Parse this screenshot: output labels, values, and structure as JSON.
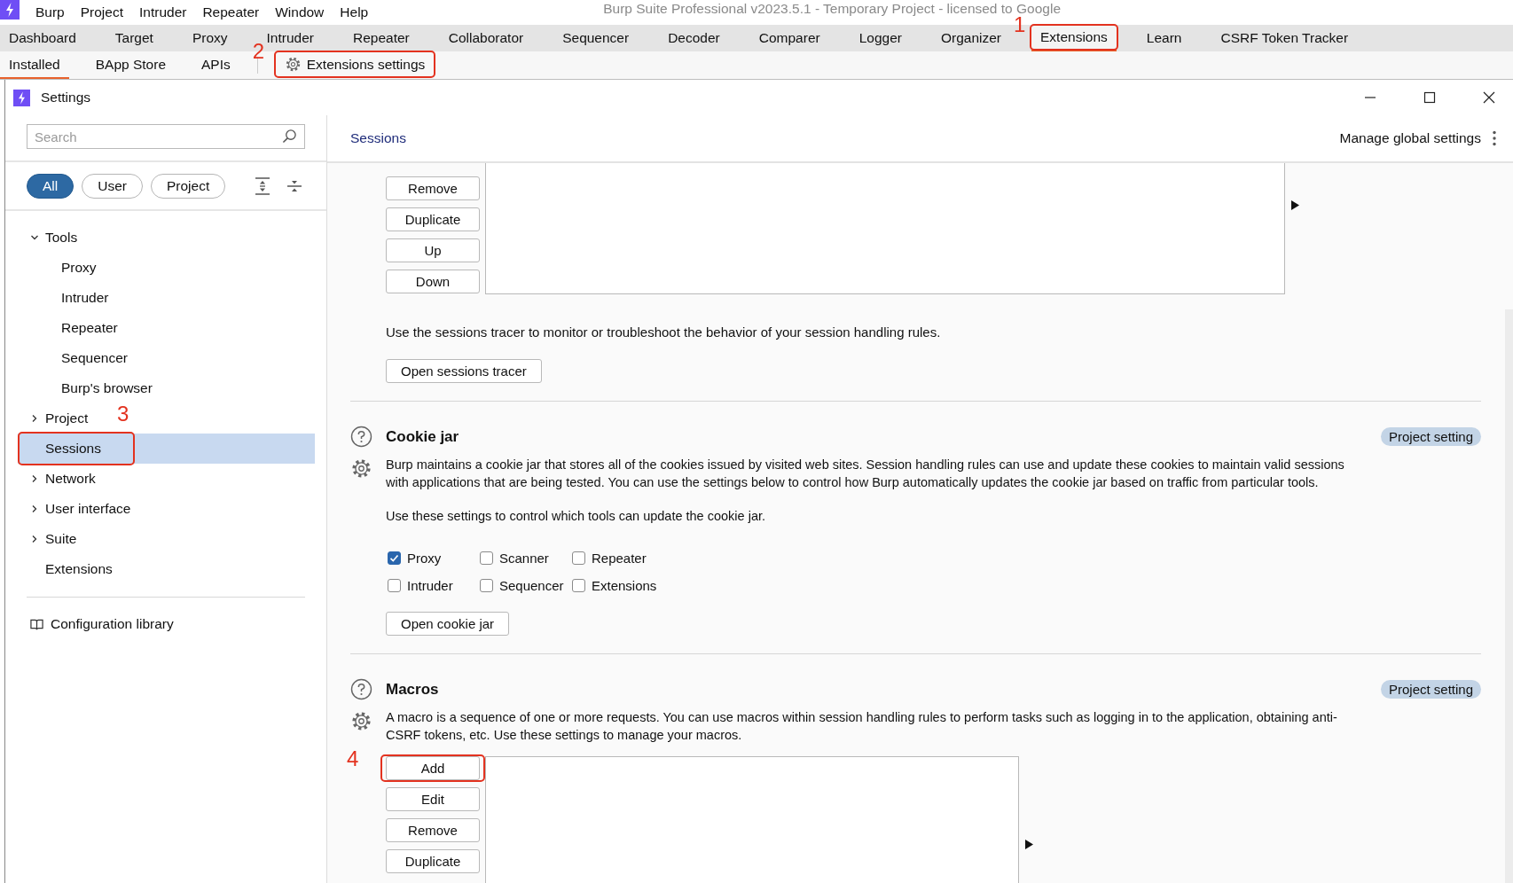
{
  "app_title": "Burp Suite Professional v2023.5.1 - Temporary Project - licensed to Google",
  "menu": [
    "Burp",
    "Project",
    "Intruder",
    "Repeater",
    "Window",
    "Help"
  ],
  "tabs": [
    {
      "label": "Dashboard",
      "selected": false
    },
    {
      "label": "Target",
      "selected": false
    },
    {
      "label": "Proxy",
      "selected": false
    },
    {
      "label": "Intruder",
      "selected": false
    },
    {
      "label": "Repeater",
      "selected": false
    },
    {
      "label": "Collaborator",
      "selected": false
    },
    {
      "label": "Sequencer",
      "selected": false
    },
    {
      "label": "Decoder",
      "selected": false
    },
    {
      "label": "Comparer",
      "selected": false
    },
    {
      "label": "Logger",
      "selected": false
    },
    {
      "label": "Organizer",
      "selected": false
    },
    {
      "label": "Extensions",
      "selected": true,
      "annotation": "1"
    },
    {
      "label": "Learn",
      "selected": false
    },
    {
      "label": "CSRF Token Tracker",
      "selected": false
    }
  ],
  "subtabs": [
    {
      "kind": "tab",
      "label": "Installed",
      "selected": true
    },
    {
      "kind": "tab",
      "label": "BApp Store",
      "selected": false
    },
    {
      "kind": "tab",
      "label": "APIs",
      "selected": false
    },
    {
      "kind": "settings",
      "label": "Extensions settings",
      "selected": false,
      "annotation": "2"
    }
  ],
  "settings": {
    "title": "Settings",
    "search": {
      "placeholder": "Search"
    },
    "filters": [
      {
        "label": "All",
        "selected": true
      },
      {
        "label": "User",
        "selected": false
      },
      {
        "label": "Project",
        "selected": false
      }
    ],
    "tree": [
      {
        "label": "Tools",
        "expanded": true,
        "selected": false,
        "children": [
          {
            "label": "Proxy",
            "selected": false
          },
          {
            "label": "Intruder",
            "selected": false
          },
          {
            "label": "Repeater",
            "selected": false
          },
          {
            "label": "Sequencer",
            "selected": false
          },
          {
            "label": "Burp's browser",
            "selected": false
          }
        ]
      },
      {
        "label": "Project",
        "expanded": false,
        "selected": false
      },
      {
        "label": "Sessions",
        "selected": true,
        "annotation": "3"
      },
      {
        "label": "Network",
        "expanded": false,
        "selected": false
      },
      {
        "label": "User interface",
        "expanded": false,
        "selected": false
      },
      {
        "label": "Suite",
        "expanded": false,
        "selected": false
      },
      {
        "label": "Extensions",
        "selected": false
      }
    ],
    "library_link": "Configuration library",
    "heading": "Sessions",
    "manage_link": "Manage global settings",
    "rules_buttons": [
      {
        "label": "Remove"
      },
      {
        "label": "Duplicate"
      },
      {
        "label": "Up"
      },
      {
        "label": "Down"
      }
    ],
    "tracer_text": "Use the sessions tracer to monitor or troubleshoot the behavior of your session handling rules.",
    "tracer_button": "Open sessions tracer",
    "sections": [
      {
        "title": "Cookie jar",
        "badge": "Project setting",
        "paragraphs": [
          "Burp maintains a cookie jar that stores all of the cookies issued by visited web sites. Session handling rules can use and update these cookies to maintain valid sessions with applications that are being tested. You can use the settings below to control how Burp automatically updates the cookie jar based on traffic from particular tools.",
          "Use these settings to control which tools can update the cookie jar."
        ],
        "checkboxes": [
          {
            "label": "Proxy",
            "checked": true
          },
          {
            "label": "Scanner",
            "checked": false
          },
          {
            "label": "Repeater",
            "checked": false
          },
          {
            "label": "Intruder",
            "checked": false
          },
          {
            "label": "Sequencer",
            "checked": false
          },
          {
            "label": "Extensions",
            "checked": false
          }
        ],
        "button": "Open cookie jar"
      },
      {
        "title": "Macros",
        "badge": "Project setting",
        "paragraphs": [
          "A macro is a sequence of one or more requests. You can use macros within session handling rules to perform tasks such as logging in to the application, obtaining anti-CSRF tokens, etc. Use these settings to manage your macros."
        ],
        "list_buttons": [
          {
            "label": "Add",
            "annotation": "4"
          },
          {
            "label": "Edit"
          },
          {
            "label": "Remove"
          },
          {
            "label": "Duplicate"
          }
        ]
      }
    ]
  }
}
